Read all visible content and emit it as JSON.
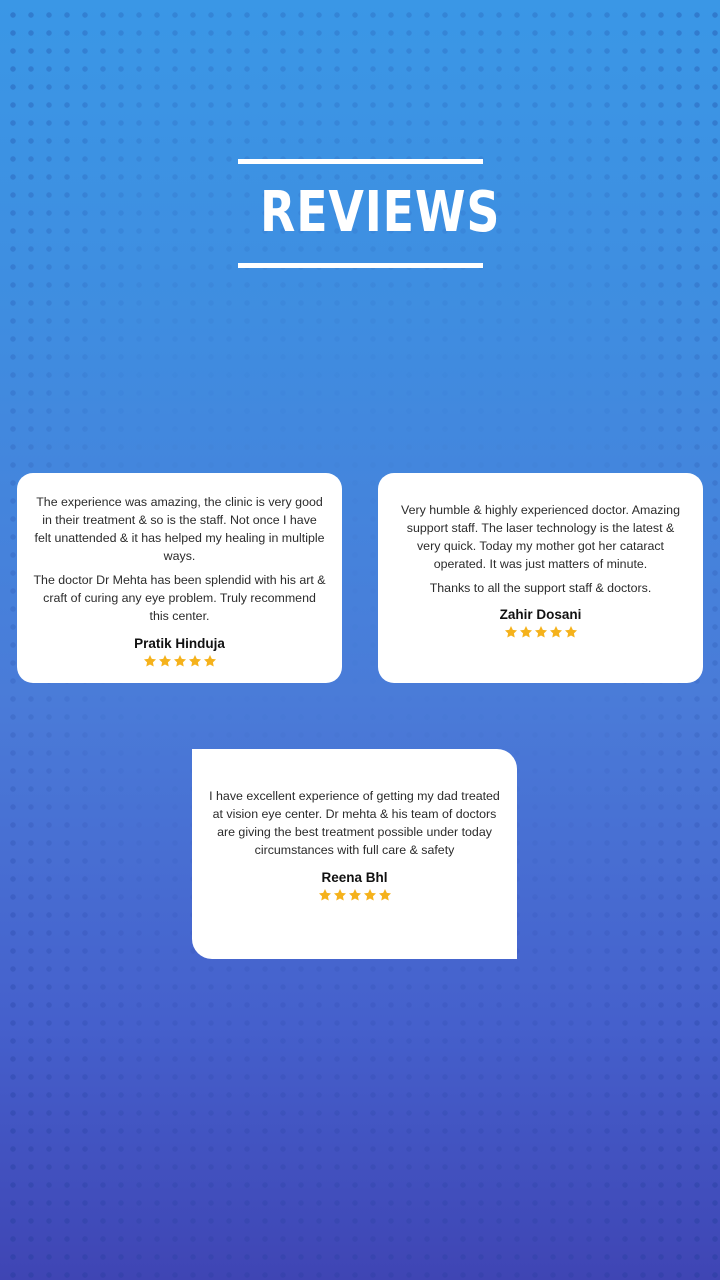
{
  "page": {
    "title": "REVIEWS"
  },
  "colors": {
    "star": "#f5b21c",
    "card_bg": "#ffffff",
    "title": "#ffffff"
  },
  "reviews": [
    {
      "paragraphs": [
        "The experience was amazing, the clinic is very good in their treatment & so is the staff. Not once I have felt unattended & it has helped my healing in multiple ways.",
        "The doctor Dr Mehta has been splendid with his art & craft of curing any eye problem. Truly recommend this center."
      ],
      "name": "Pratik Hinduja",
      "rating": 5
    },
    {
      "paragraphs": [
        "Very humble & highly experienced doctor. Amazing support staff. The laser technology is the latest & very quick. Today my mother got her cataract operated. It was just matters of minute.",
        "Thanks to all the support staff & doctors."
      ],
      "name": "Zahir Dosani",
      "rating": 5
    },
    {
      "paragraphs": [
        "I have excellent experience of getting my dad treated at vision eye center. Dr mehta & his team of doctors are giving the best treatment possible under today circumstances with full care & safety"
      ],
      "name": "Reena Bhl",
      "rating": 5
    }
  ]
}
